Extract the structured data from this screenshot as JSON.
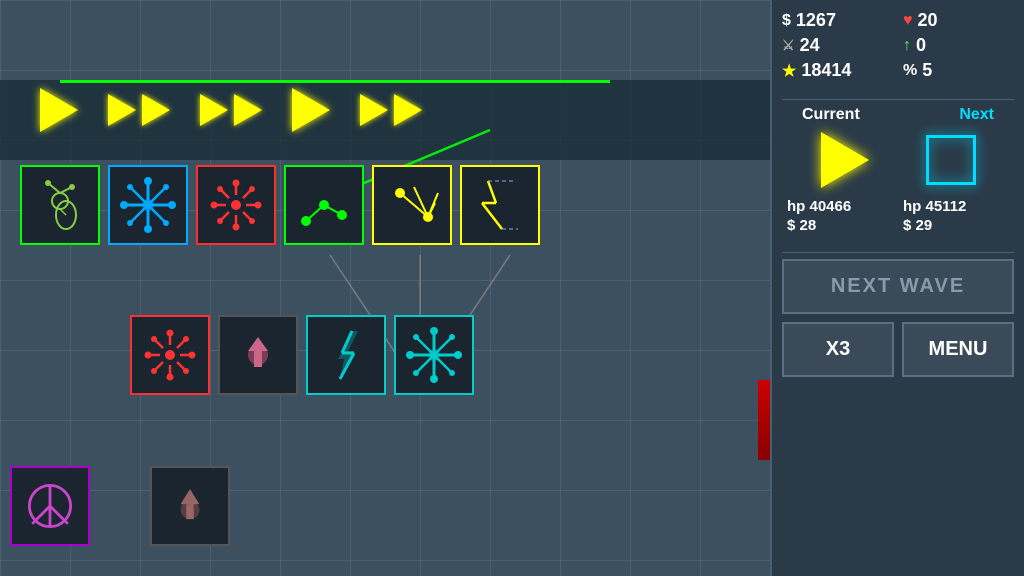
{
  "stats": {
    "money": "1267",
    "hearts": "20",
    "sword": "24",
    "arrow_up": "0",
    "star": "18414",
    "percent": "5",
    "money_icon": "$",
    "heart_icon": "♥",
    "sword_icon": "⚔",
    "up_icon": "↑",
    "star_icon": "★",
    "percent_icon": "%"
  },
  "wave_info": {
    "current_label": "Current",
    "next_label": "Next",
    "current_hp": "hp 40466",
    "current_cost": "$ 28",
    "next_hp": "hp 45112",
    "next_cost": "$ 29"
  },
  "buttons": {
    "next_wave": "NEXT WAVE",
    "x3": "X3",
    "menu": "MENU"
  }
}
